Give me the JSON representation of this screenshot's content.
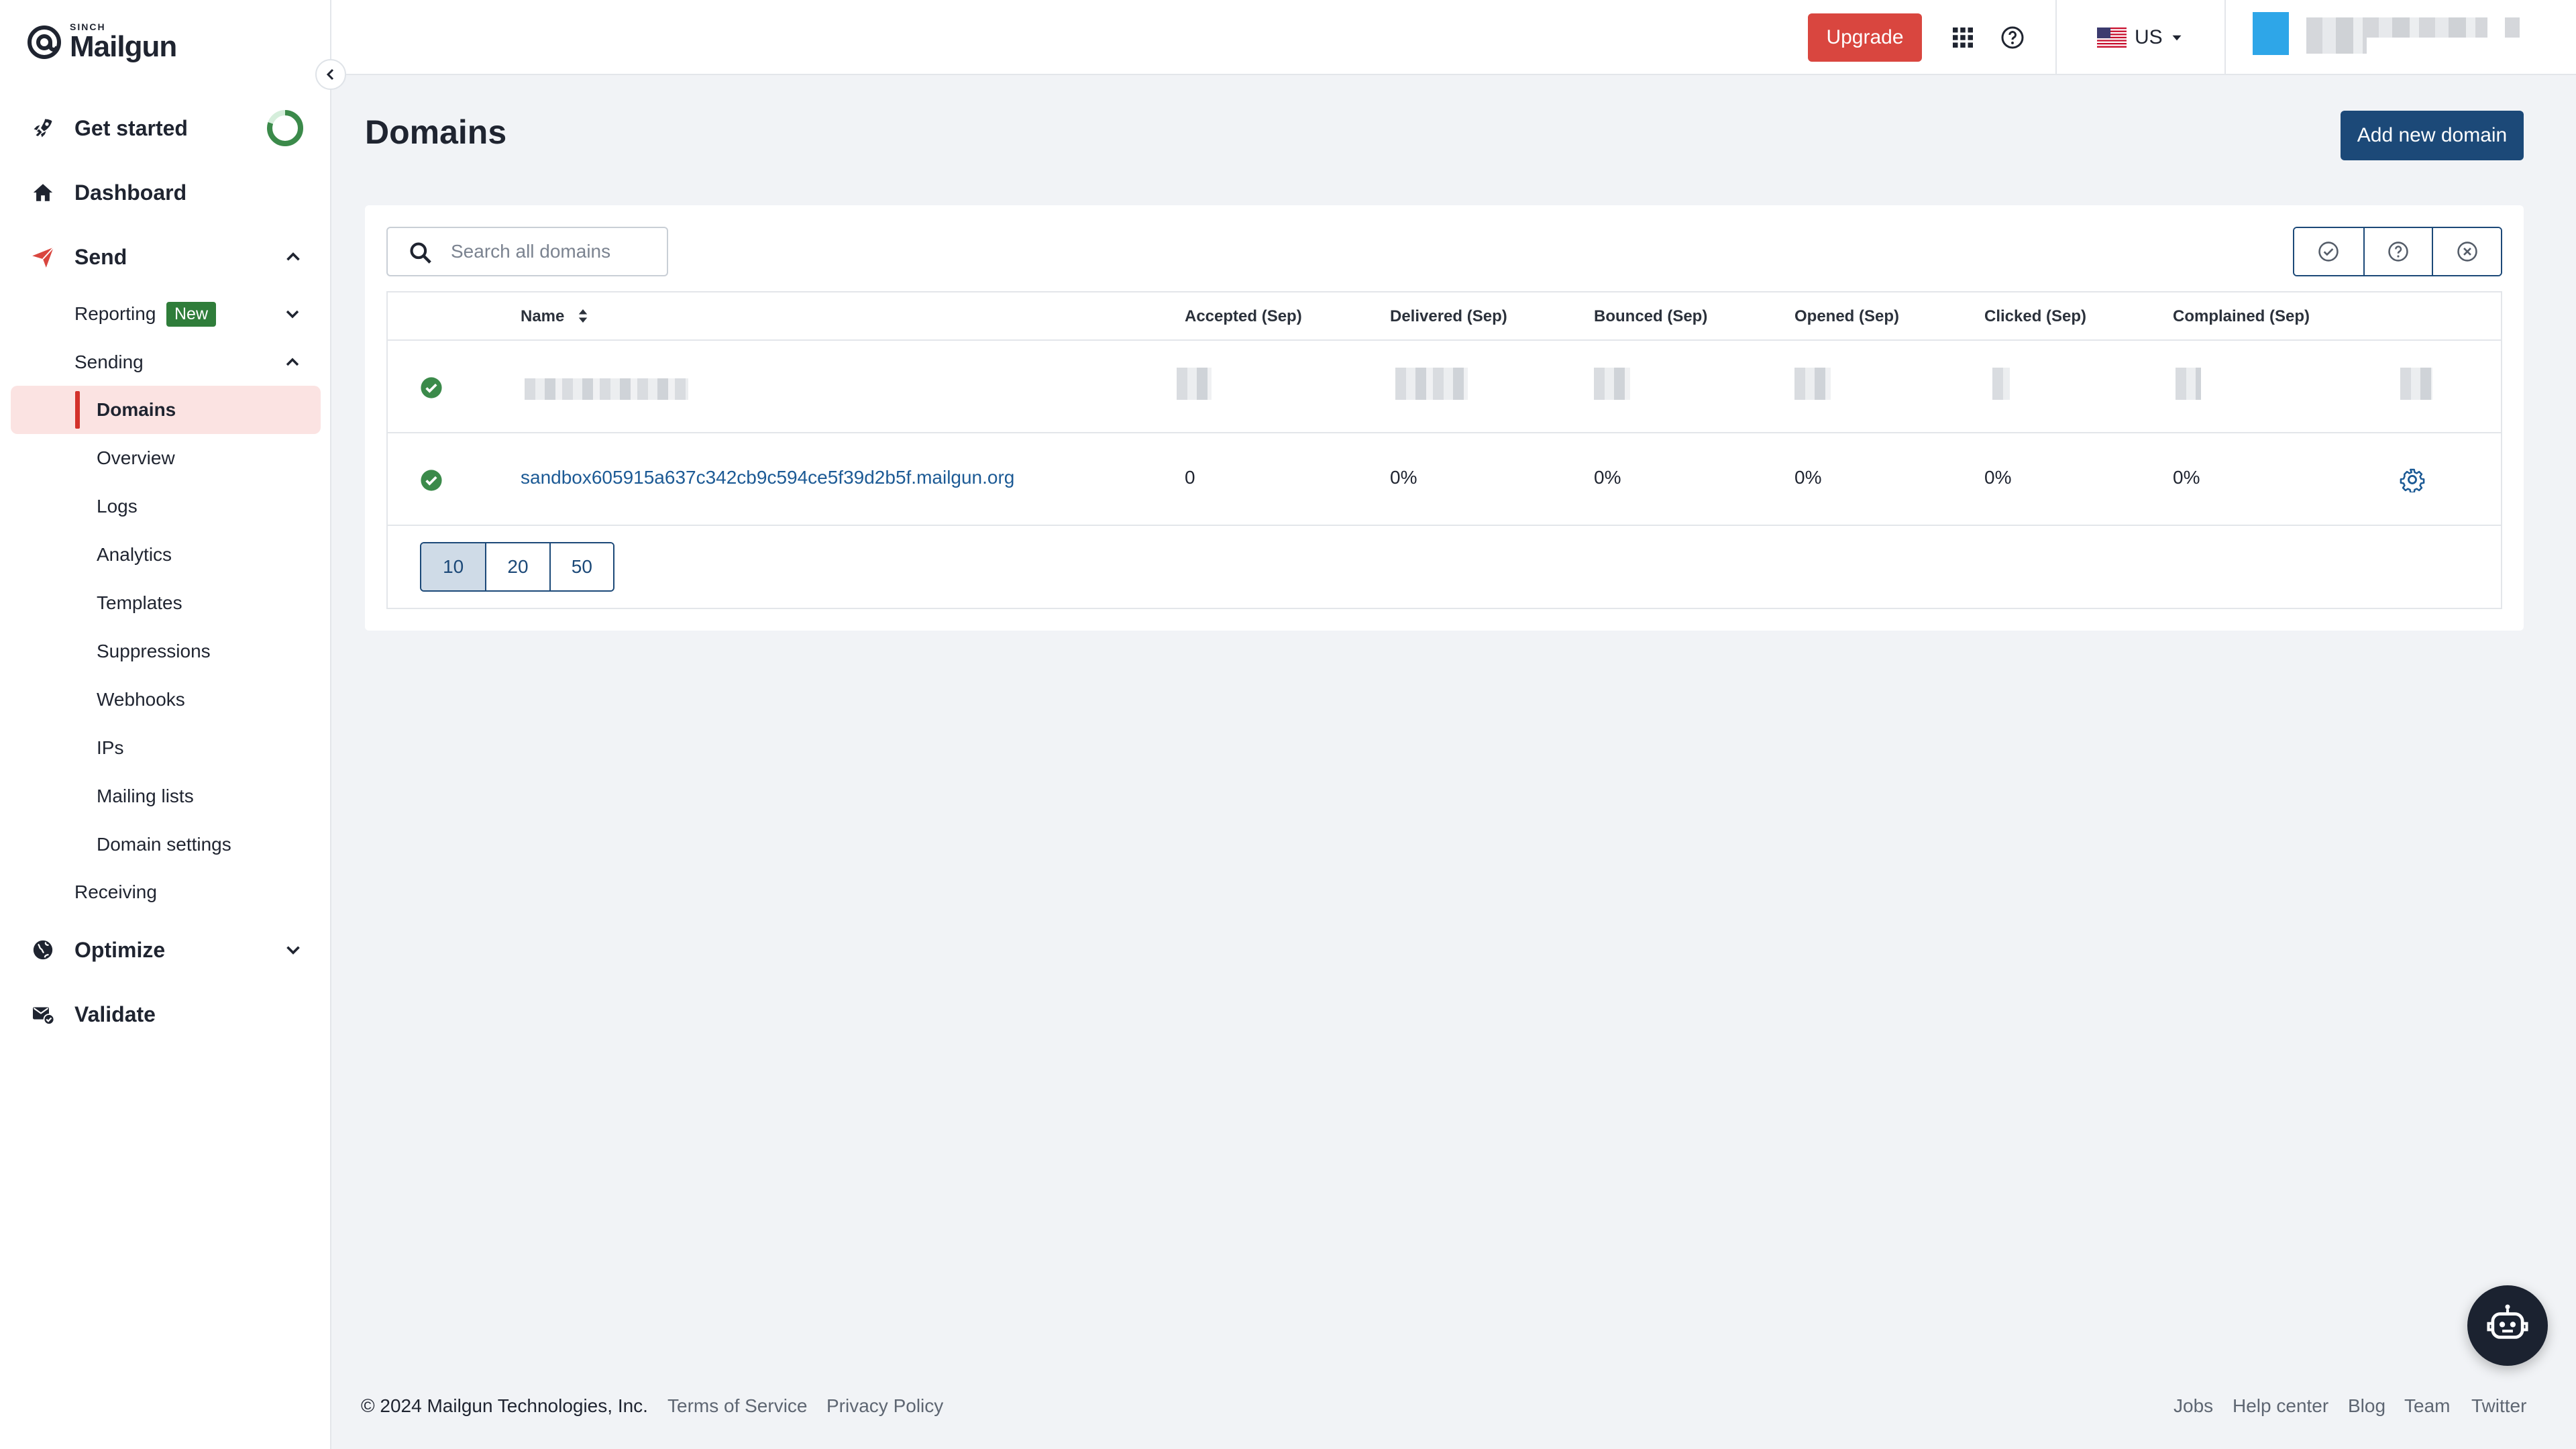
{
  "brand": {
    "top": "SINCH",
    "name": "Mailgun"
  },
  "topbar": {
    "upgrade_label": "Upgrade",
    "region_label": "US"
  },
  "sidebar": {
    "get_started": "Get started",
    "dashboard": "Dashboard",
    "send": "Send",
    "reporting": "Reporting",
    "reporting_badge": "New",
    "sending": "Sending",
    "sending_items": [
      "Domains",
      "Overview",
      "Logs",
      "Analytics",
      "Templates",
      "Suppressions",
      "Webhooks",
      "IPs",
      "Mailing lists",
      "Domain settings"
    ],
    "receiving": "Receiving",
    "optimize": "Optimize",
    "validate": "Validate",
    "get_started_progress": 0.8,
    "active_item": "Domains"
  },
  "main": {
    "title": "Domains",
    "add_domain_label": "Add new domain",
    "search_placeholder": "Search all domains",
    "columns": [
      "Name",
      "Accepted (Sep)",
      "Delivered (Sep)",
      "Bounced (Sep)",
      "Opened (Sep)",
      "Clicked (Sep)",
      "Complained (Sep)"
    ],
    "rows": [
      {
        "status": "verified",
        "name": "sandbox605915a637c342cb9c594ce5f39d2b5f.mailgun.org",
        "accepted": "0",
        "delivered": "0%",
        "bounced": "0%",
        "opened": "0%",
        "clicked": "0%",
        "complained": "0%"
      }
    ],
    "page_sizes": [
      "10",
      "20",
      "50"
    ],
    "selected_page_size": "10"
  },
  "footer": {
    "copyright": "© 2024 Mailgun Technologies, Inc.",
    "terms": "Terms of Service",
    "privacy": "Privacy Policy",
    "links": [
      "Jobs",
      "Help center",
      "Blog",
      "Team",
      "Twitter"
    ]
  },
  "colors": {
    "accent": "#d9463f",
    "primary": "#1c4978",
    "success": "#3b8a4a",
    "link": "#1c5a95",
    "active_bg": "#fbe3e2"
  }
}
